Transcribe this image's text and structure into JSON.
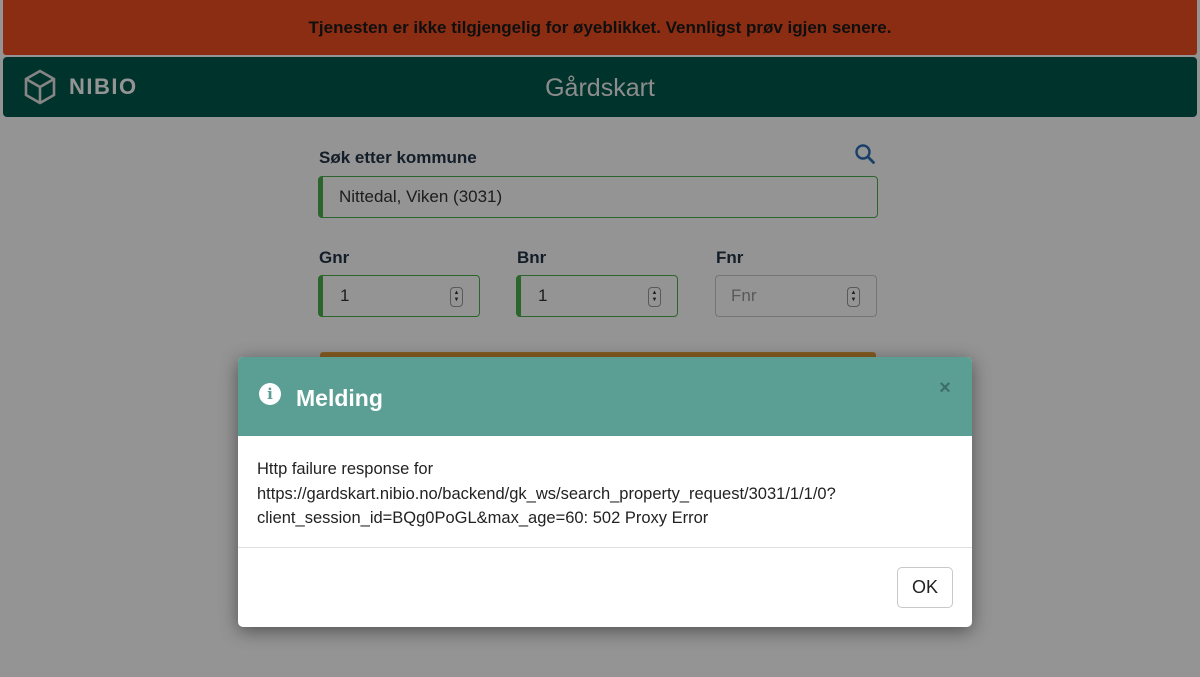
{
  "banner": {
    "message": "Tjenesten er ikke tilgjengelig for øyeblikket. Vennligst prøv igjen senere.",
    "color": "#ef4e1f"
  },
  "header": {
    "logo_text": "NIBIO",
    "logo_icon": "nibio-logo-icon",
    "app_title": "Gårdskart",
    "color": "#00594c"
  },
  "search": {
    "label": "Søk etter kommune",
    "value": "Nittedal, Viken (3031)",
    "icon": "search-icon"
  },
  "fields": {
    "gnr": {
      "label": "Gnr",
      "value": "1"
    },
    "bnr": {
      "label": "Bnr",
      "value": "1"
    },
    "fnr": {
      "label": "Fnr",
      "placeholder": "Fnr"
    }
  },
  "dialog": {
    "title": "Melding",
    "icon": "info-icon",
    "close_symbol": "×",
    "message_line1": "Http failure response for",
    "message_line2": "https://gardskart.nibio.no/backend/gk_ws/search_property_request/3031/1/1/0?",
    "message_line3": "client_session_id=BQg0PoGL&max_age=60: 502 Proxy Error",
    "ok_label": "OK",
    "header_color": "#5a9e94"
  }
}
